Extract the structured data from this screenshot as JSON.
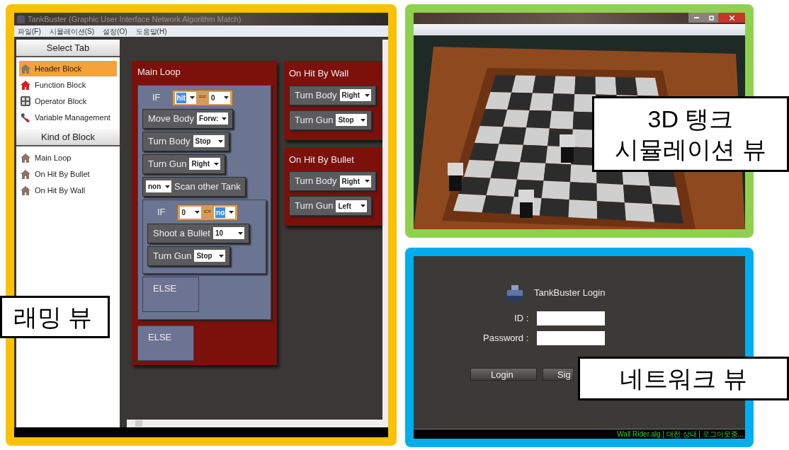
{
  "programming_view": {
    "window": {
      "title": "TankBuster (Graphic User Interface Network Algorithm Match)"
    },
    "menu": [
      "파일(F)",
      "시뮬레이션(S)",
      "설정(O)",
      "도움말(H)"
    ],
    "sidebar": [
      {
        "title": "Select Tab",
        "items": [
          {
            "label": "Header Block",
            "kind": "house",
            "selected": true
          },
          {
            "label": "Function Block",
            "kind": "house-red",
            "selected": false
          },
          {
            "label": "Operator Block",
            "kind": "grid",
            "selected": false
          },
          {
            "label": "Variable Management",
            "kind": "wrench",
            "selected": false
          }
        ]
      },
      {
        "title": "Kind of Block",
        "items": [
          {
            "label": "Main Loop",
            "kind": "house",
            "selected": false
          },
          {
            "label": "On Hit By Bullet",
            "kind": "house",
            "selected": false
          },
          {
            "label": "On Hit By Wall",
            "kind": "house",
            "selected": false
          }
        ]
      }
    ],
    "main_loop": {
      "title": "Main Loop",
      "body": [
        {
          "kind": "if",
          "label": "IF",
          "left": {
            "value": "hit",
            "selected": true
          },
          "operator": "==",
          "right": {
            "value": "0",
            "selected": false
          },
          "children": [
            {
              "kind": "action",
              "label": "Move Body",
              "value": "Forw:"
            },
            {
              "kind": "action",
              "label": "Turn Body",
              "value": "Stop"
            },
            {
              "kind": "action",
              "label": "Turn Gun",
              "value": "Right"
            },
            {
              "kind": "scan",
              "label": "Scan other Tank",
              "value": "non"
            },
            {
              "kind": "if",
              "label": "IF",
              "left": {
                "value": "0",
                "selected": false
              },
              "operator": "<=",
              "right": {
                "value": "no",
                "selected": true
              },
              "children": [
                {
                  "kind": "action",
                  "label": "Shoot a Bullet",
                  "value": "10"
                },
                {
                  "kind": "action",
                  "label": "Turn Gun",
                  "value": "Stop"
                }
              ]
            },
            {
              "kind": "else",
              "label": "ELSE"
            }
          ]
        },
        {
          "kind": "else",
          "label": "ELSE"
        }
      ]
    },
    "handlers": [
      {
        "title": "On Hit By Wall",
        "body": [
          {
            "kind": "action",
            "label": "Turn Body",
            "value": "Right"
          },
          {
            "kind": "action",
            "label": "Turn Gun",
            "value": "Stop"
          }
        ]
      },
      {
        "title": "On Hit By Bullet",
        "body": [
          {
            "kind": "action",
            "label": "Turn Body",
            "value": "Right"
          },
          {
            "kind": "action",
            "label": "Turn Gun",
            "value": "Left"
          }
        ]
      }
    ]
  },
  "network_view": {
    "title": "TankBuster Login",
    "fields": [
      {
        "label": "ID :"
      },
      {
        "label": "Password :"
      }
    ],
    "buttons": [
      "Login",
      "Sig"
    ],
    "status_bar": "Wall Rider.alg | 대전 상태 | 로그아웃중..."
  },
  "callouts": [
    {
      "kind": "programming",
      "lines": [
        "래밍 뷰"
      ]
    },
    {
      "kind": "simulation",
      "lines": [
        "3D 탱크",
        "시뮬레이션 뷰"
      ]
    },
    {
      "kind": "network",
      "lines": [
        "네트워크 뷰"
      ]
    }
  ]
}
